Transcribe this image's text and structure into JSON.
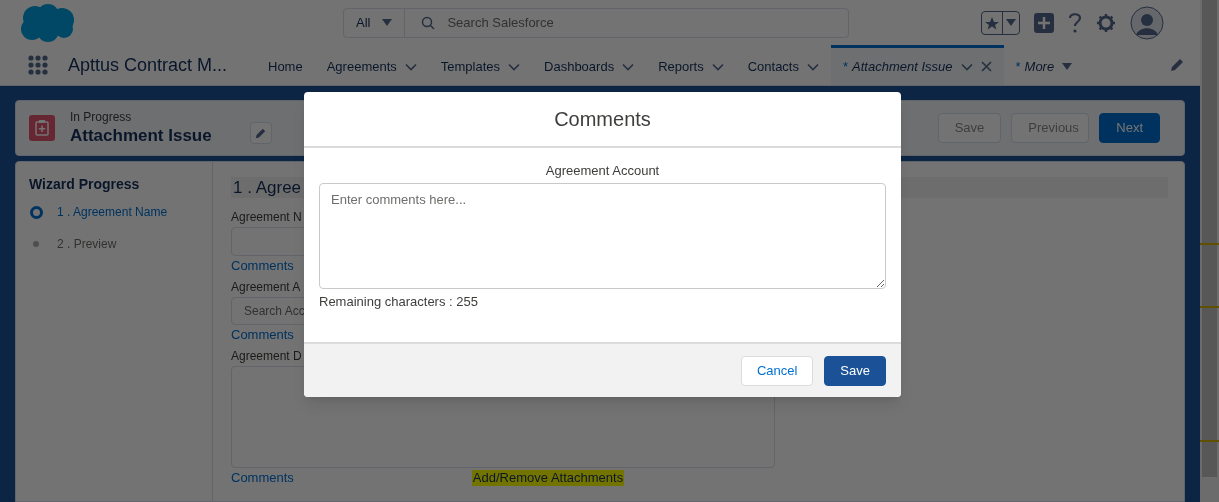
{
  "header": {
    "search_scope": "All",
    "search": {
      "placeholder": "Search Salesforce"
    }
  },
  "nav": {
    "app_name": "Apttus Contract M...",
    "tabs": [
      {
        "label": "Home",
        "kind": "plain",
        "selected": false
      },
      {
        "label": "Agreements",
        "kind": "menu",
        "selected": false
      },
      {
        "label": "Templates",
        "kind": "menu",
        "selected": false
      },
      {
        "label": "Dashboards",
        "kind": "menu",
        "selected": false
      },
      {
        "label": "Reports",
        "kind": "menu",
        "selected": false
      },
      {
        "label": "Contacts",
        "kind": "menu",
        "selected": false
      },
      {
        "label": "Attachment Issue",
        "marker": "*",
        "kind": "record",
        "selected": true
      },
      {
        "label": "More",
        "marker": "*",
        "kind": "overflow",
        "selected": false
      }
    ]
  },
  "record": {
    "status": "In Progress",
    "title": "Attachment Issue",
    "actions": [
      {
        "label": "Save",
        "kind": "neutral",
        "disabled": true
      },
      {
        "label": "Previous",
        "kind": "neutral",
        "disabled": true
      },
      {
        "label": "Next",
        "kind": "brand",
        "disabled": false
      }
    ]
  },
  "wizard": {
    "title": "Wizard Progress",
    "steps": [
      {
        "label": "1 . Agreement Name",
        "selected": true
      },
      {
        "label": "2 . Preview",
        "selected": false
      }
    ]
  },
  "form": {
    "heading": "1 . Agree",
    "fields": [
      {
        "kind": "text",
        "label": "Agreement N",
        "link": "Comments"
      },
      {
        "kind": "lookup",
        "label": "Agreement A",
        "placeholder": "Search Acc",
        "link": "Comments"
      },
      {
        "kind": "textarea",
        "label": "Agreement D",
        "link": "Comments",
        "extra_link": "Add/Remove Attachments"
      }
    ]
  },
  "modal": {
    "title": "Comments",
    "field_label": "Agreement Account",
    "placeholder": "Enter comments here...",
    "remaining": "Remaining characters : 255",
    "buttons": [
      {
        "label": "Cancel",
        "kind": "neutral"
      },
      {
        "label": "Save",
        "kind": "brand"
      }
    ]
  }
}
